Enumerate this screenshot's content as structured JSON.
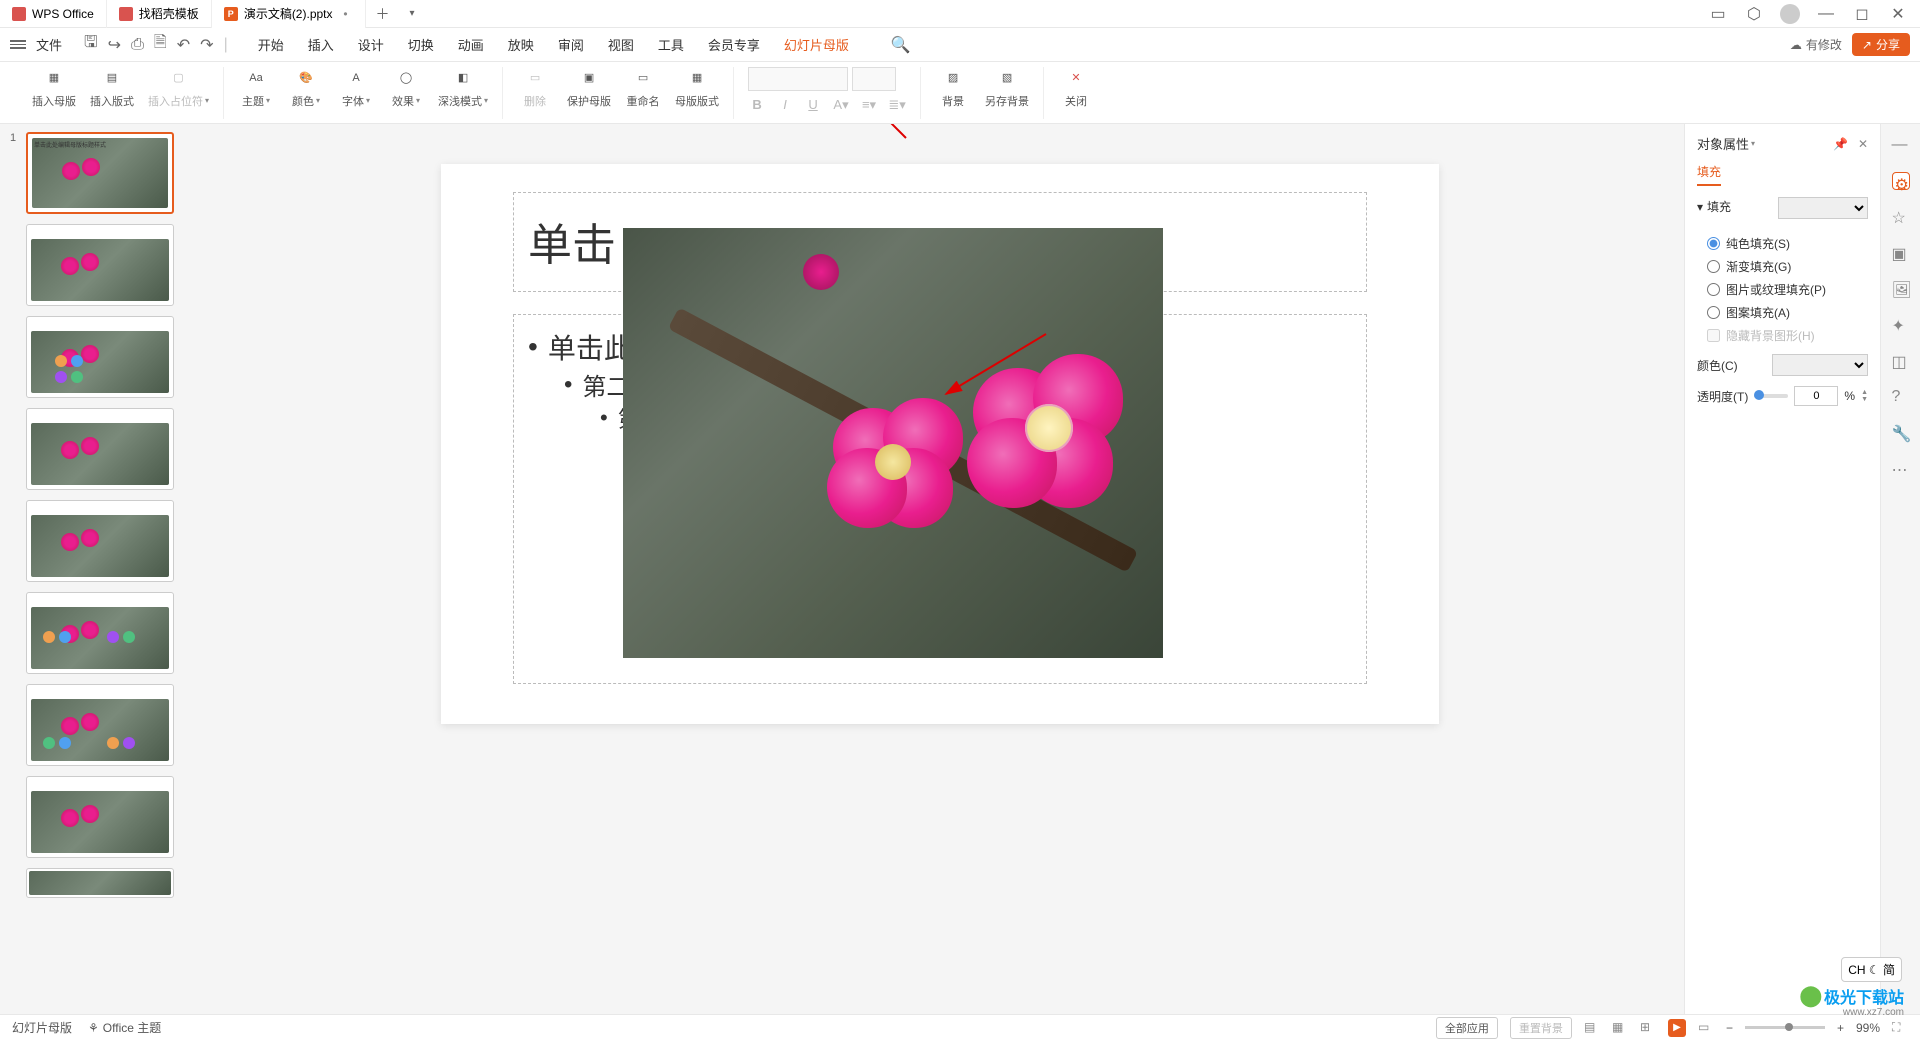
{
  "tabs": {
    "wps": "WPS Office",
    "doc": "找稻壳模板",
    "ppt": "演示文稿(2).pptx"
  },
  "menu": {
    "file": "文件",
    "items": [
      "开始",
      "插入",
      "设计",
      "切换",
      "动画",
      "放映",
      "审阅",
      "视图",
      "工具",
      "会员专享",
      "幻灯片母版"
    ],
    "modify": "有修改",
    "share": "分享"
  },
  "ribbon": {
    "insert_master": "插入母版",
    "insert_layout": "插入版式",
    "insert_placeholder": "插入占位符",
    "theme": "主题",
    "color": "颜色",
    "font": "字体",
    "effect": "效果",
    "dark_mode": "深浅模式",
    "delete": "删除",
    "protect": "保护母版",
    "rename": "重命名",
    "master_layout": "母版版式",
    "background": "背景",
    "save_bg": "另存背景",
    "close": "关闭"
  },
  "slide": {
    "title": "单击",
    "bullet1": "单击此",
    "bullet2": "第二",
    "bullet3": "第"
  },
  "panel": {
    "title": "对象属性",
    "tab_fill": "填充",
    "section_fill": "填充",
    "solid": "纯色填充(S)",
    "gradient": "渐变填充(G)",
    "picture": "图片或纹理填充(P)",
    "pattern": "图案填充(A)",
    "hide_bg": "隐藏背景图形(H)",
    "color": "颜色(C)",
    "transparency": "透明度(T)",
    "trans_val": "0",
    "trans_unit": "%"
  },
  "status": {
    "master_view": "幻灯片母版",
    "theme": "Office 主题",
    "apply_all": "全部应用",
    "reset_bg": "重置背景",
    "zoom": "99%"
  },
  "ime": "CH ☾ 简",
  "watermark": {
    "main": "极光下载站",
    "sub": "www.xz7.com"
  }
}
